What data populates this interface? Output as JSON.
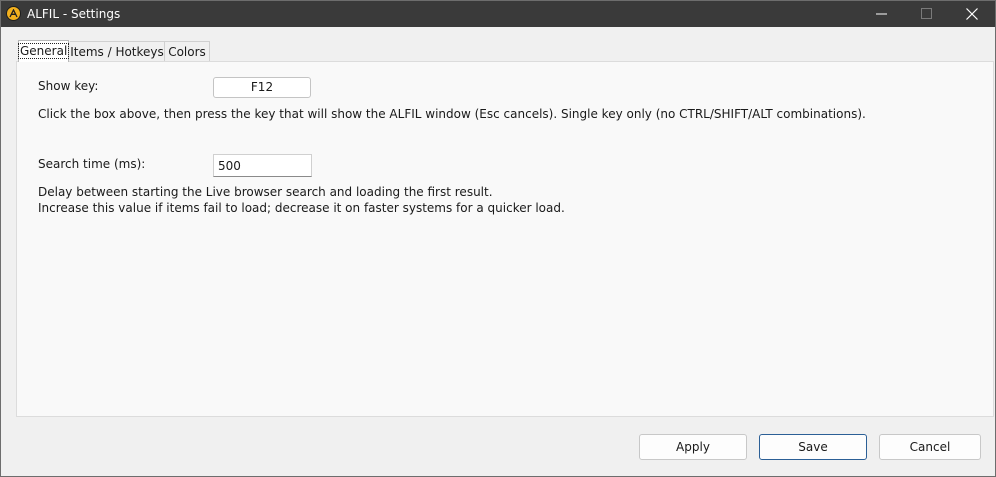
{
  "window": {
    "title": "ALFIL - Settings"
  },
  "icons": {
    "app": "alfil-logo-icon",
    "minimize": "minimize-icon",
    "maximize": "maximize-icon",
    "close": "close-icon"
  },
  "tabs": [
    {
      "label": "General",
      "selected": true
    },
    {
      "label": "Items / Hotkeys",
      "selected": false
    },
    {
      "label": "Colors",
      "selected": false
    }
  ],
  "general": {
    "show_key_label": "Show key:",
    "show_key_value": "F12",
    "show_key_help": "Click the box above, then press the key that will show the ALFIL window (Esc cancels). Single key only (no CTRL/SHIFT/ALT combinations).",
    "search_time_label": "Search time (ms):",
    "search_time_value": "500",
    "search_time_help_1": "Delay between starting the Live browser search and loading the first result.",
    "search_time_help_2": "Increase this value if items fail to load; decrease it on faster systems for a quicker load."
  },
  "buttons": {
    "apply": "Apply",
    "save": "Save",
    "cancel": "Cancel"
  },
  "colors": {
    "titlebar_bg": "#3a3a3a",
    "window_bg": "#f0f0f0",
    "panel_bg": "#f9f9f9",
    "default_button_border": "#2b5f96",
    "app_icon": "#f2b01e"
  }
}
